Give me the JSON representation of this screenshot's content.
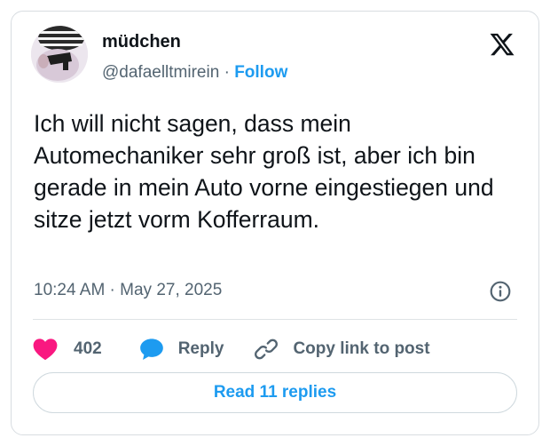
{
  "author": {
    "display_name": "müdchen",
    "handle": "@dafaelltmirein",
    "separator": "·",
    "follow_label": "Follow"
  },
  "tweet": {
    "text": "Ich will nicht sagen, dass mein Automechaniker sehr groß ist, aber ich bin gerade in mein Auto vorne eingestiegen und sitze jetzt vorm Kofferraum.",
    "timestamp": "10:24 AM · May 27, 2025"
  },
  "actions": {
    "like_count": "402",
    "reply_label": "Reply",
    "copy_label": "Copy link to post"
  },
  "read_replies_label": "Read 11 replies",
  "icons": {
    "brand": "x-logo-icon",
    "info": "info-icon",
    "like": "heart-icon",
    "reply": "speech-bubble-icon",
    "copy": "link-icon"
  },
  "colors": {
    "accent": "#1d9bf0",
    "like": "#f91880",
    "text": "#0f1419",
    "secondary": "#536471"
  }
}
